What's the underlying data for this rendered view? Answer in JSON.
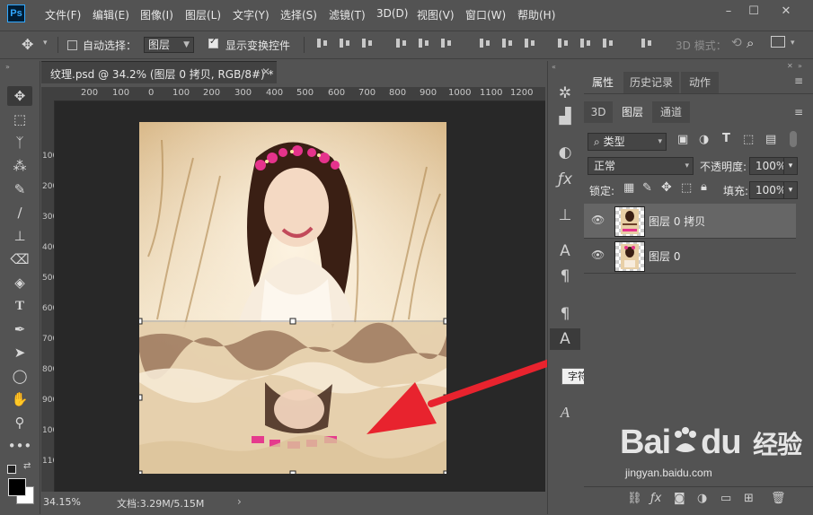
{
  "app": {
    "logo_text": "Ps",
    "menu": [
      "文件(F)",
      "编辑(E)",
      "图像(I)",
      "图层(L)",
      "文字(Y)",
      "选择(S)",
      "滤镜(T)",
      "3D(D)",
      "视图(V)",
      "窗口(W)",
      "帮助(H)"
    ],
    "window_controls": [
      "minimize",
      "maximize",
      "close"
    ]
  },
  "options": {
    "auto_select_label": "自动选择：",
    "auto_select_checked": false,
    "auto_select_target": "图层",
    "show_transform_label": "显示变换控件",
    "show_transform_checked": true,
    "mode_3d_label": "3D 模式："
  },
  "document": {
    "tab_title": "纹理.psd @ 34.2% (图层 0 拷贝, RGB/8#) *",
    "ruler_top": [
      "200",
      "100",
      "0",
      "100",
      "200",
      "300",
      "400",
      "500",
      "600",
      "700",
      "800",
      "900",
      "1000",
      "1100",
      "1200"
    ],
    "ruler_left": [
      "100",
      "200",
      "300",
      "400",
      "500",
      "600",
      "700",
      "800",
      "900",
      "1000",
      "1100"
    ],
    "zoom": "34.15%",
    "doc_size": "文档:3.29M/5.15M"
  },
  "tooltip": "字符样式",
  "panel": {
    "top_tabs": [
      "属性",
      "历史记录",
      "动作"
    ],
    "sub_tabs": [
      "3D",
      "图层",
      "通道"
    ],
    "active_sub_tab": "图层",
    "filter_kind": "类型",
    "blend_mode": "正常",
    "opacity_label": "不透明度:",
    "opacity_value": "100%",
    "lock_label": "锁定:",
    "fill_label": "填充:",
    "fill_value": "100%",
    "layers": [
      {
        "name": "图层 0 拷贝",
        "selected": true,
        "visible": true
      },
      {
        "name": "图层 0",
        "selected": false,
        "visible": true
      }
    ]
  },
  "watermark": {
    "brand": "Bai",
    "brand2": "du",
    "cn": "经验",
    "url": "jingyan.baidu.com"
  },
  "colors": {
    "accent": "#31a8ff",
    "arrow": "#e8232e",
    "panel_bg": "#535353",
    "canvas_bg": "#282828"
  }
}
